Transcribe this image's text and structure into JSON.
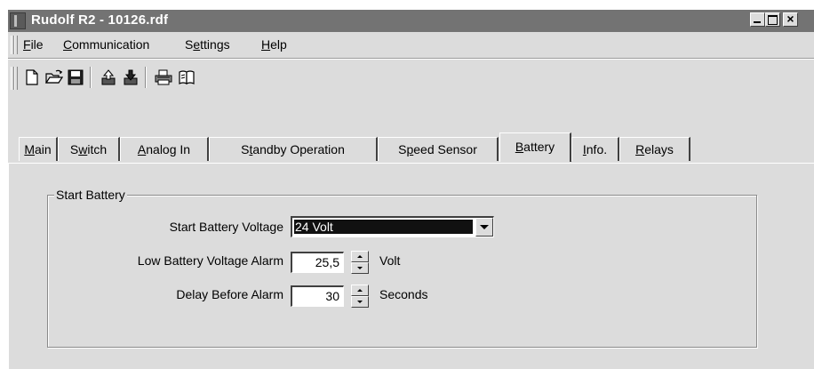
{
  "window": {
    "title": "Rudolf R2 - 10126.rdf"
  },
  "menu": [
    {
      "label": "File",
      "accel": "F",
      "rest": "ile"
    },
    {
      "label": "Communication",
      "accel": "C",
      "rest": "ommunication"
    },
    {
      "label": "Settings",
      "pre": "S",
      "accel": "e",
      "rest": "ttings"
    },
    {
      "label": "Help",
      "accel": "H",
      "rest": "elp"
    }
  ],
  "toolbar": {
    "icons": [
      "new-file-icon",
      "open-folder-icon",
      "save-disk-icon",
      "upload-icon",
      "download-icon",
      "print-icon",
      "manual-book-icon"
    ]
  },
  "tabs": [
    {
      "label": "Main",
      "pre": "",
      "accel": "M",
      "rest": "ain"
    },
    {
      "label": "Switch",
      "pre": "S",
      "accel": "w",
      "rest": "itch"
    },
    {
      "label": "Analog In",
      "pre": "",
      "accel": "A",
      "rest": "nalog In"
    },
    {
      "label": "Standby Operation",
      "pre": "S",
      "accel": "t",
      "rest": "andby Operation"
    },
    {
      "label": "Speed Sensor",
      "pre": "S",
      "accel": "p",
      "rest": "eed Sensor"
    },
    {
      "label": "Battery",
      "pre": "",
      "accel": "B",
      "rest": "attery"
    },
    {
      "label": "Info.",
      "pre": "",
      "accel": "I",
      "rest": "nfo."
    },
    {
      "label": "Relays",
      "pre": "",
      "accel": "R",
      "rest": "elays"
    }
  ],
  "active_tab": "Battery",
  "group": {
    "title": "Start Battery",
    "voltage_label": "Start Battery Voltage",
    "voltage_value": "24 Volt",
    "low_alarm_label": "Low Battery Voltage Alarm",
    "low_alarm_value": "25,5",
    "low_alarm_unit": "Volt",
    "delay_label": "Delay Before Alarm",
    "delay_value": "30",
    "delay_unit": "Seconds"
  }
}
